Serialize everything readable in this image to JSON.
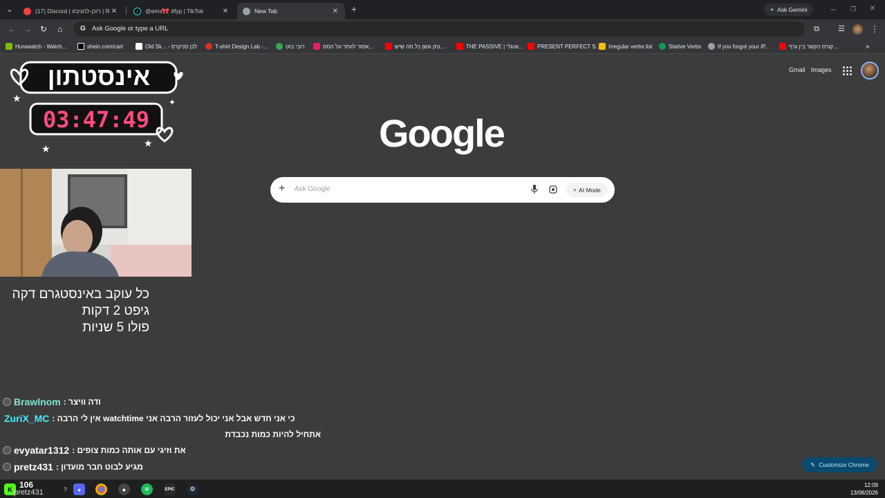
{
  "tabs": [
    {
      "title": "(17) Discord | #רוכן-להגיב | Ro...",
      "favicon": "discord-icon",
      "active": false
    },
    {
      "title": "@emз🎀 #fyp | TikTok",
      "favicon": "tiktok-icon",
      "active": false
    },
    {
      "title": "New Tab",
      "favicon": "chrome-icon",
      "active": true
    }
  ],
  "ask_gemini": "Ask Gemini",
  "omnibox": {
    "placeholder": "Ask Google or type a URL"
  },
  "bookmarks": [
    {
      "label": "Hurawatch - Watch...",
      "color": "#7cbb00"
    },
    {
      "label": "shein.com/cart",
      "color": "#000000"
    },
    {
      "label": "Old Sk... - לכן סניקרס",
      "color": "#ffffff"
    },
    {
      "label": "T-shirt Design Lab -...",
      "color": "#d93025"
    },
    {
      "label": "רובי בוט",
      "color": "#34a853"
    },
    {
      "label": "אסור לוותר על המס...",
      "color": "#e91e63"
    },
    {
      "label": "נתן גושן כל מה שיש...",
      "color": "#ff0000"
    },
    {
      "label": "THE PASSIVE | אנגלי...",
      "color": "#ff0000"
    },
    {
      "label": "PRESENT PERFECT S...",
      "color": "#ff0000"
    },
    {
      "label": "Irregular verbs list",
      "color": "#fbbc04"
    },
    {
      "label": "Stative Verbs",
      "color": "#0f9d58"
    },
    {
      "label": "If you forgot your iP...",
      "color": "#9aa0a6"
    },
    {
      "label": "קורס הקשר בין גרף...",
      "color": "#ff0000"
    }
  ],
  "header": {
    "gmail": "Gmail",
    "images": "Images"
  },
  "google_logo": "Google",
  "search": {
    "placeholder": "Ask Google",
    "ai_mode": "AI Mode"
  },
  "customize": "Customize Chrome",
  "overlay": {
    "title": "אינסטתון",
    "timer": "03:47:49",
    "rules": [
      "כל עוקב באינסטגרם דקה",
      "גיפט 2 דקות",
      "פולו 5 שניות"
    ]
  },
  "chat": [
    {
      "name": "Brawlnom",
      "text": "ודה וויצר :"
    },
    {
      "name": "ZuriX_MC",
      "text": "כי אני חדש אבל אני יכול לעזור הרבה אני watchtime אין לי הרבה :",
      "continued": "אתחיל להיות כמות נכבדת"
    },
    {
      "name": "evyatar1312",
      "text": "את וזיגי עם אותה כמות צופים :"
    },
    {
      "name": "pretz431",
      "text": "מגיע לבוט חבר מועדון :"
    }
  ],
  "taskbar": {
    "badge": "106",
    "user": "pretz431",
    "time": "12:09",
    "date": "13/08/2026"
  }
}
